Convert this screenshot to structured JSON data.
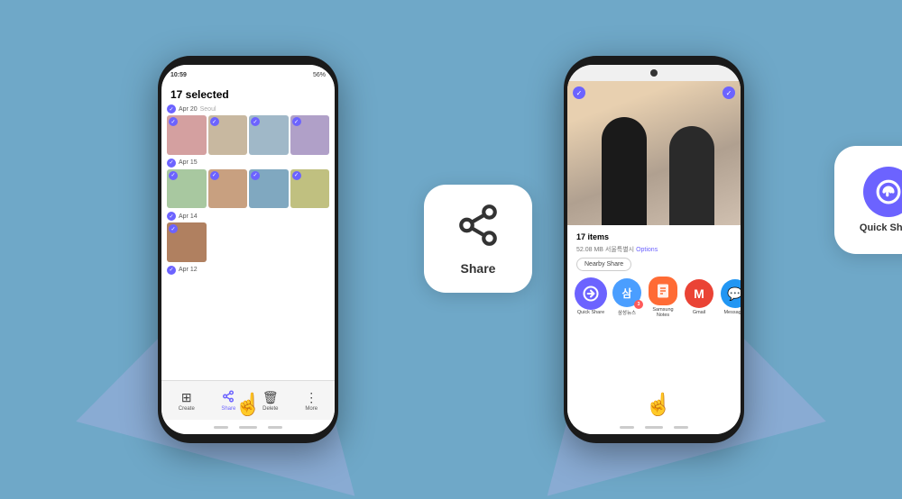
{
  "scene": {
    "background_color": "#6fa8c8"
  },
  "phone1": {
    "status_bar": {
      "time": "10:59",
      "battery": "56%",
      "icons": "wifi signal"
    },
    "header": {
      "title": "17 selected"
    },
    "date_sections": [
      {
        "date": "Apr 20",
        "location": "Seoul",
        "checked": true
      },
      {
        "date": "Apr 15",
        "checked": true
      },
      {
        "date": "Apr 14",
        "checked": true
      },
      {
        "date": "Apr 12",
        "checked": true
      }
    ],
    "toolbar": {
      "items": [
        {
          "label": "Create",
          "icon": "⊞"
        },
        {
          "label": "Share",
          "icon": "≮",
          "active": true
        },
        {
          "label": "Delete",
          "icon": "🗑"
        },
        {
          "label": "More",
          "icon": "⋮"
        }
      ]
    },
    "share_popup": {
      "label": "Share"
    }
  },
  "phone2": {
    "items_info": {
      "count": "17 items",
      "size": "52.08 MB",
      "location": "서울특별시",
      "options_label": "Options"
    },
    "nearby_share_label": "Nearby Share",
    "apps": [
      {
        "name": "Quick Share",
        "color": "#6c63ff",
        "icon": "↻",
        "highlighted": true
      },
      {
        "name": "삼성뉴스",
        "color": "#4a9eff",
        "icon": "삼",
        "badge": "3"
      },
      {
        "name": "Samsung Notes",
        "color": "#ffd700",
        "icon": "📝"
      },
      {
        "name": "Gmail",
        "color": "#ea4335",
        "icon": "M"
      },
      {
        "name": "Messages",
        "color": "#2196f3",
        "icon": "💬"
      }
    ],
    "quick_share_popup": {
      "label": "Quick Share"
    }
  }
}
